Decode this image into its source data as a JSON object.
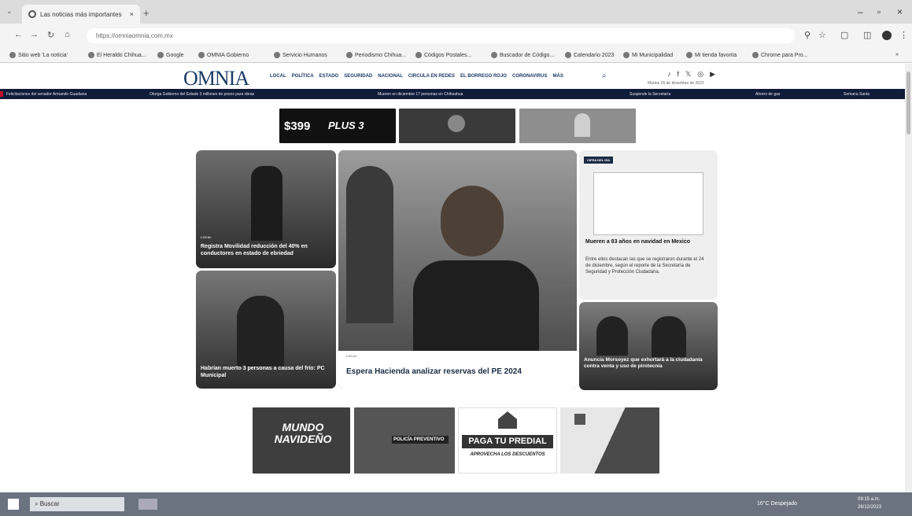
{
  "browser": {
    "tab_title": "Las noticias más importantes",
    "tab_close": "×",
    "new_tab": "+",
    "tab_menu": "⌄",
    "url": "https://omniaomnia.com.mx",
    "win_min": "–",
    "win_max": "▫",
    "win_close": "×",
    "nav": {
      "back": "←",
      "forward": "→",
      "reload": "↻",
      "home": "⌂"
    },
    "bookmarks": [
      "Sitio web 'La noticia'",
      "El Heraldo Chihua...",
      "Google",
      "OMNIA Gobierno",
      "Servicio Humanos",
      "Periodismo Chihua...",
      "Códigos Postales...",
      "Buscador de Código...",
      "Calendario 2023",
      "Mi Municipalidad",
      "Mi tienda favorita",
      "Chrome para Pro..."
    ],
    "bookmarks_more": "»"
  },
  "site": {
    "logo": "OMNIA",
    "nav": [
      "LOCAL",
      "POLÍTICA",
      "ESTADO",
      "SEGURIDAD",
      "NACIONAL",
      "CIRCULA EN REDES",
      "EL BORREGO ROJO",
      "CORONAVIRUS",
      "MÁS"
    ],
    "search_icon": "⌕",
    "social": [
      "♪",
      "f",
      "𝕏",
      "◎",
      "▶"
    ],
    "date": "Martes 26 de diciembre de 2023"
  },
  "ticker": [
    "Felicitaciones del senador Armando Guadiana",
    "Otorga Gobierno del Estado 3 millones de pesos para obras",
    "Mueren en diciembre 17 personas en Chihuahua",
    "Suspende la Secretaría",
    "Ahorro de gas",
    "Semana Santa"
  ],
  "ads": {
    "price": "$399",
    "price_suffix": "PLUS 3",
    "mundo": "MUNDO NAVIDEÑO",
    "policia": "POLICÍA PREVENTIVO",
    "predial_title": "PAGA TU PREDIAL",
    "predial_sub": "APROVECHA LOS DESCUENTOS"
  },
  "cards": {
    "c1": {
      "kicker": "LOCAL",
      "headline": "Registra Movilidad reducción del 40% en conductores en estado de ebriedad"
    },
    "c2": {
      "headline": "Habrían muerto 3 personas a causa del frío: PC Municipal"
    },
    "c3": {
      "kicker": "LOCAL",
      "headline": "Espera Hacienda analizar reservas del PE 2024"
    },
    "c4": {
      "tag": "CIFRA DEL DÍA",
      "headline": "Mueren a 83 años en navidad en Mexico",
      "body": "Entre ellos destacan las que se registraron durante el 24 de diciembre, según el reporte de la Secretaría de Seguridad y Protección Ciudadana."
    },
    "c5": {
      "headline": "Anuncia Morsoyez que exhortará a la ciudadanía contra venta y uso de pirotecnia"
    }
  },
  "taskbar": {
    "search": "Buscar",
    "weather": "16°C Despejado",
    "time": "09:15 a.m.",
    "date": "26/12/2023"
  }
}
